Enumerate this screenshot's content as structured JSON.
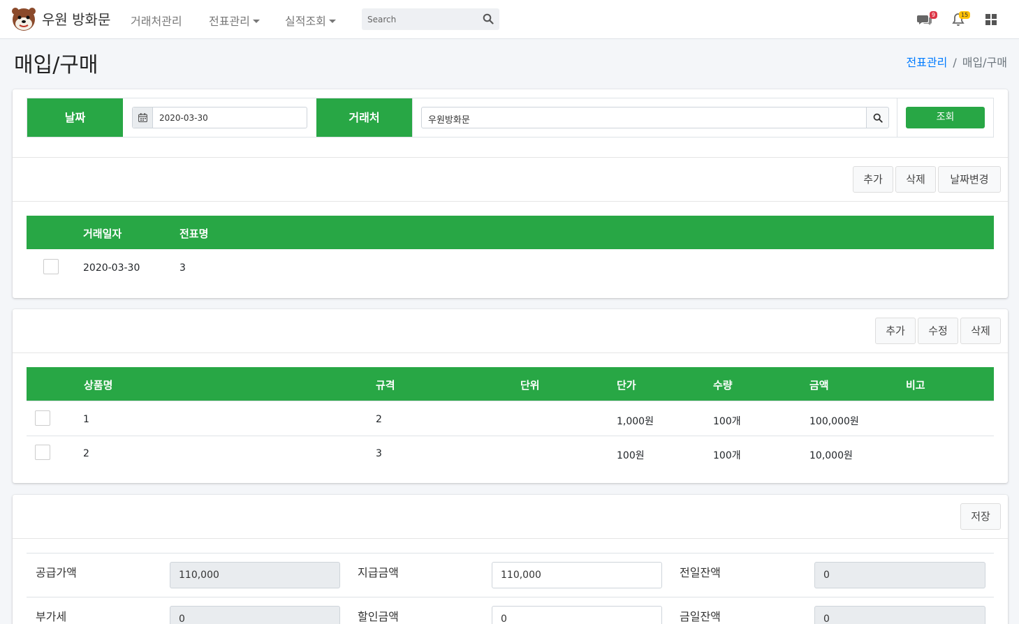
{
  "navbar": {
    "brand": "우원 방화문",
    "links": [
      {
        "label": "거래처관리",
        "dropdown": false
      },
      {
        "label": "전표관리",
        "dropdown": true
      },
      {
        "label": "실적조회",
        "dropdown": true
      }
    ],
    "search_placeholder": "Search",
    "messages_count": "9",
    "notifications_count": "15"
  },
  "page": {
    "title": "매입/구매",
    "breadcrumb": [
      "전표관리",
      "매입/구매"
    ]
  },
  "filter": {
    "date_label": "날짜",
    "date_value": "2020-03-30",
    "vendor_label": "거래처",
    "vendor_value": "우원방화문",
    "search_button": "조회"
  },
  "vouchers": {
    "buttons": [
      "추가",
      "삭제",
      "날짜변경"
    ],
    "columns": [
      "거래일자",
      "전표명"
    ],
    "rows": [
      {
        "date": "2020-03-30",
        "name": "3"
      }
    ]
  },
  "items": {
    "buttons": [
      "추가",
      "수정",
      "삭제"
    ],
    "columns": [
      "상품명",
      "규격",
      "단위",
      "단가",
      "수량",
      "금액",
      "비고"
    ],
    "rows": [
      {
        "name": "1",
        "spec": "2",
        "unit": "",
        "price": "1,000원",
        "qty": "100개",
        "amount": "100,000원",
        "note": ""
      },
      {
        "name": "2",
        "spec": "3",
        "unit": "",
        "price": "100원",
        "qty": "100개",
        "amount": "10,000원",
        "note": ""
      }
    ]
  },
  "summary": {
    "save_button": "저장",
    "supply_label": "공급가액",
    "supply_value": "110,000",
    "paid_label": "지급금액",
    "paid_value": "110,000",
    "prev_balance_label": "전일잔액",
    "prev_balance_value": "0",
    "vat_label": "부가세",
    "vat_value": "0",
    "discount_label": "할인금액",
    "discount_value": "0",
    "today_balance_label": "금일잔액",
    "today_balance_value": "0"
  },
  "colors": {
    "accent": "#28a745",
    "link": "#007bff"
  }
}
